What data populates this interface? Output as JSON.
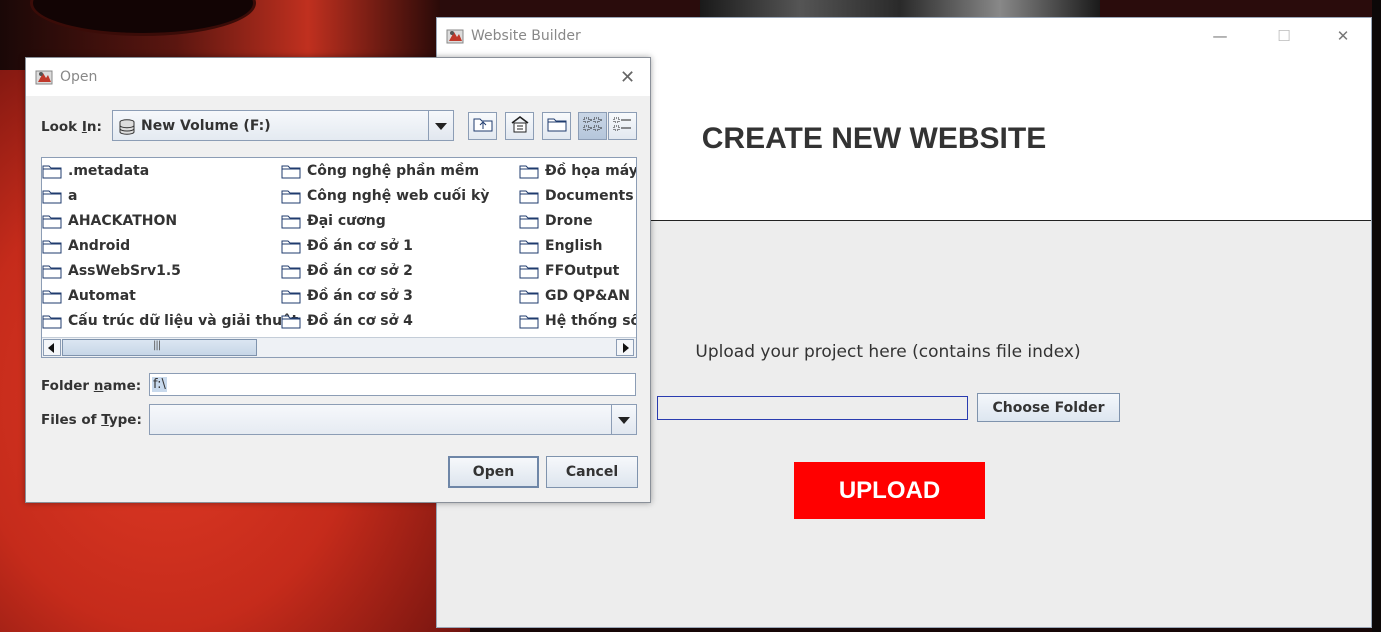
{
  "website_builder": {
    "title": "Website Builder",
    "heading": "CREATE NEW WEBSITE",
    "upload_caption": "Upload your project here (contains file index)",
    "path_value": "",
    "choose_button": "Choose Folder",
    "upload_button": "UPLOAD",
    "upload_color": "#ff0000",
    "controls": {
      "minimize": "—",
      "maximize": "☐",
      "close": "✕"
    }
  },
  "open_dialog": {
    "title": "Open",
    "look_in_label_pre": "Look ",
    "look_in_label_u": "I",
    "look_in_label_post": "n:",
    "look_in_value": "New Volume (F:)",
    "toolbar_icons": [
      "up-folder-icon",
      "home-icon",
      "new-folder-icon",
      "list-view-icon",
      "details-view-icon"
    ],
    "columns": [
      [
        ".metadata",
        "a",
        "AHACKATHON",
        "Android",
        "AssWebSrv1.5",
        "Automat",
        "Cấu trúc dữ liệu và giải thuật"
      ],
      [
        "Công nghệ phần mềm",
        "Công nghệ web cuối kỳ",
        "Đại cương",
        "Đồ án cơ sở 1",
        "Đồ án cơ sở 2",
        "Đồ án cơ sở 3",
        "Đồ án cơ sở 4"
      ],
      [
        "Đồ họa máy tính",
        "Documents",
        "Drone",
        "English",
        "FFOutput",
        "GD QP&AN",
        "Hệ thống số"
      ]
    ],
    "folder_name_label_pre": "Folder ",
    "folder_name_label_u": "n",
    "folder_name_label_post": "ame:",
    "folder_name_value": "f:\\",
    "files_of_type_label_pre": "Files of ",
    "files_of_type_label_u": "T",
    "files_of_type_label_post": "ype:",
    "files_of_type_value": "",
    "open_button": "Open",
    "cancel_button": "Cancel"
  }
}
